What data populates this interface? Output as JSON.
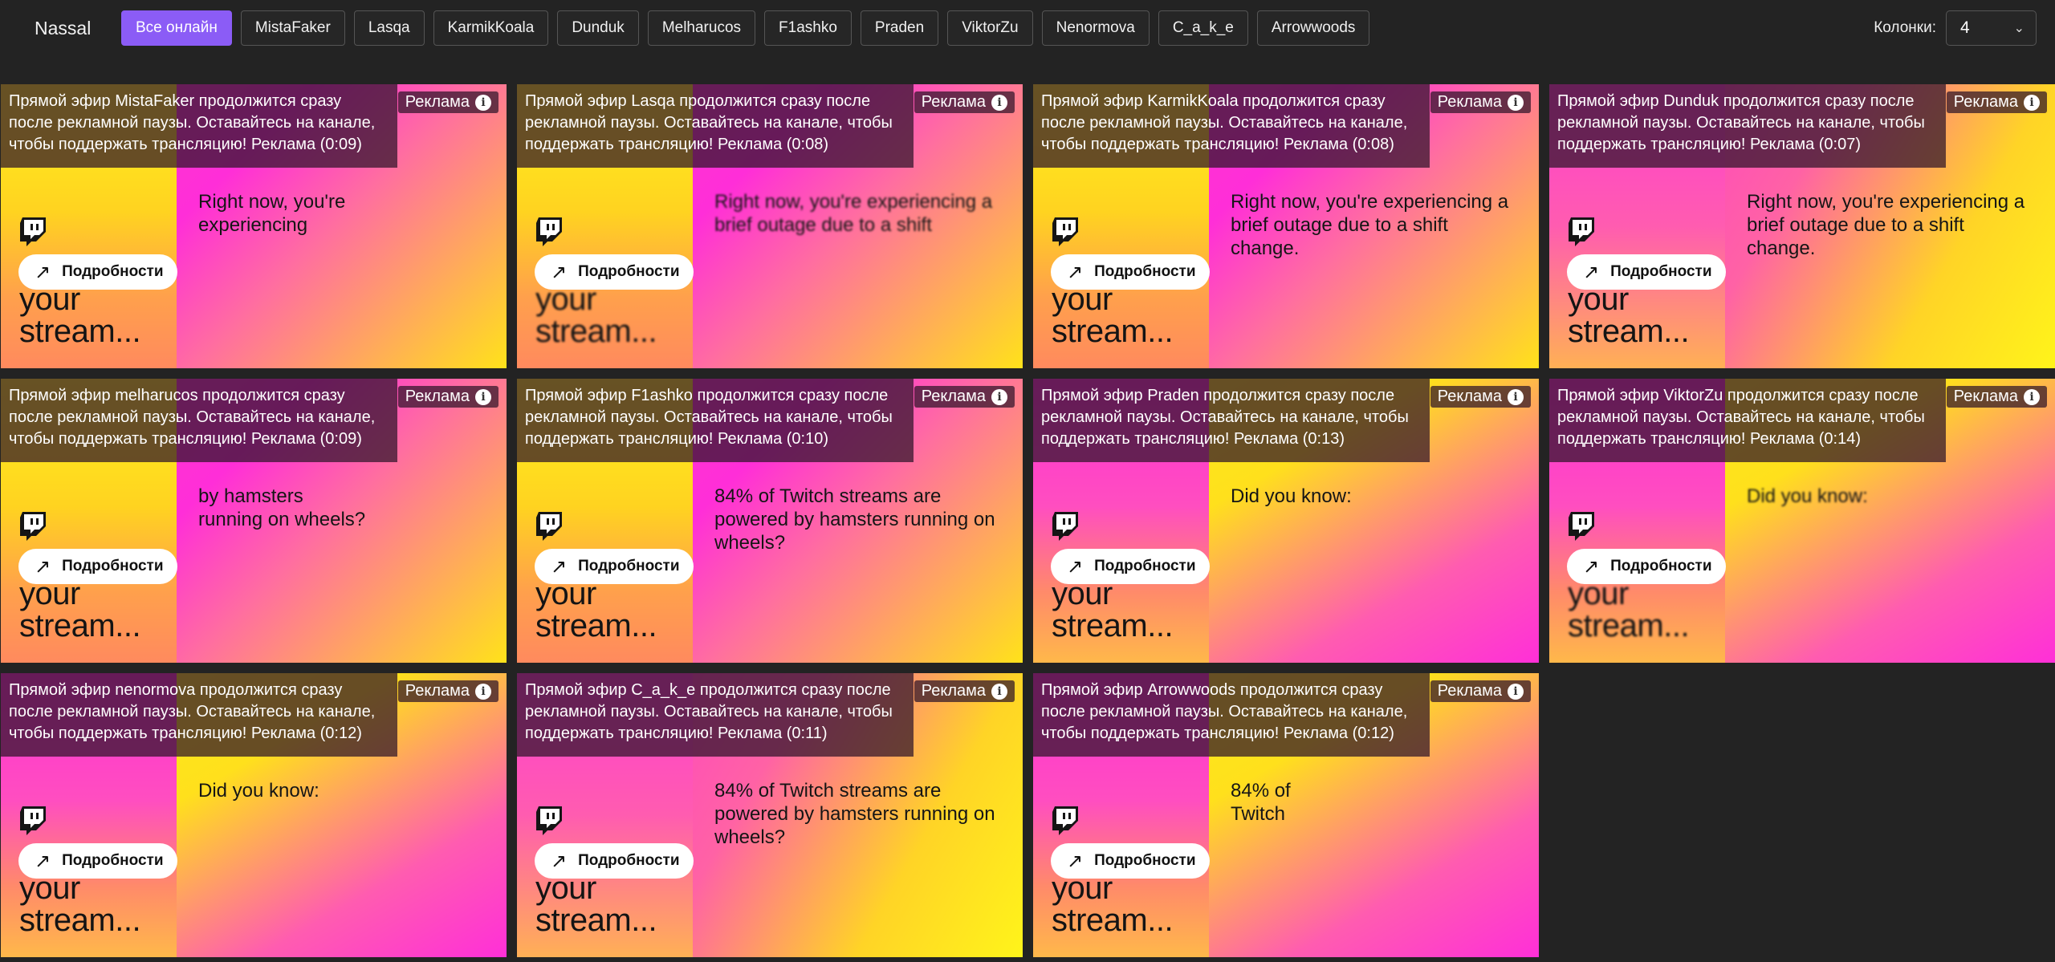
{
  "app": {
    "brand": "Nassal"
  },
  "tabs": [
    {
      "label": "Все онлайн",
      "active": true
    },
    {
      "label": "MistaFaker"
    },
    {
      "label": "Lasqa"
    },
    {
      "label": "KarmikKoala"
    },
    {
      "label": "Dunduk"
    },
    {
      "label": "Melharucos"
    },
    {
      "label": "F1ashko"
    },
    {
      "label": "Praden"
    },
    {
      "label": "ViktorZu"
    },
    {
      "label": "Nenormova"
    },
    {
      "label": "C_a_k_e"
    },
    {
      "label": "Arrowwoods"
    }
  ],
  "columns": {
    "label": "Колонки:",
    "value": "4"
  },
  "common": {
    "ad_badge": "Реклама",
    "details": "Подробности",
    "stream_line1": "your",
    "stream_line2": "stream..."
  },
  "tiles": [
    {
      "message": "Прямой эфир MistaFaker продолжится сразу после рекламной паузы. Оставайтесь на канале, чтобы поддержать трансляцию! Реклама (0:09)",
      "promo": "Right now, you're\nexperiencing",
      "variant": "v1"
    },
    {
      "message": "Прямой эфир Lasqa продолжится сразу после рекламной паузы. Оставайтесь на канале, чтобы поддержать трансляцию! Реклама (0:08)",
      "promo": "Right now, you're experiencing a brief outage due to a shift",
      "variant": "v1"
    },
    {
      "message": "Прямой эфир KarmikKoala продолжится сразу после рекламной паузы. Оставайтесь на канале, чтобы поддержать трансляцию! Реклама (0:08)",
      "promo": "Right now, you're experiencing a brief outage due to a shift change.",
      "variant": "v1"
    },
    {
      "message": "Прямой эфир Dunduk продолжится сразу после рекламной паузы. Оставайтесь на канале, чтобы поддержать трансляцию! Реклама (0:07)",
      "promo": "Right now, you're experiencing a brief outage due to a shift change.",
      "variant": "v2"
    },
    {
      "message": "Прямой эфир melharucos продолжится сразу после рекламной паузы. Оставайтесь на канале, чтобы поддержать трансляцию! Реклама (0:09)",
      "promo": "by hamsters\nrunning on wheels?",
      "variant": "v1"
    },
    {
      "message": "Прямой эфир F1ashko продолжится сразу после рекламной паузы. Оставайтесь на канале, чтобы поддержать трансляцию! Реклама (0:10)",
      "promo": "84% of Twitch streams are powered by hamsters running on wheels?",
      "variant": "v1"
    },
    {
      "message": "Прямой эфир Praden продолжится сразу после рекламной паузы. Оставайтесь на канале, чтобы поддержать трансляцию! Реклама (0:13)",
      "promo": "Did you know:",
      "variant": "v3"
    },
    {
      "message": "Прямой эфир ViktorZu продолжится сразу после рекламной паузы. Оставайтесь на канале, чтобы поддержать трансляцию! Реклама (0:14)",
      "promo": "Did you know:",
      "variant": "v3"
    },
    {
      "message": "Прямой эфир nenormova продолжится сразу после рекламной паузы. Оставайтесь на канале, чтобы поддержать трансляцию! Реклама (0:12)",
      "promo": "Did you know:",
      "variant": "v3"
    },
    {
      "message": "Прямой эфир C_a_k_e продолжится сразу после рекламной паузы. Оставайтесь на канале, чтобы поддержать трансляцию! Реклама (0:11)",
      "promo": "84% of Twitch streams are powered by hamsters running on wheels?",
      "variant": "v2"
    },
    {
      "message": "Прямой эфир Arrowwoods продолжится сразу после рекламной паузы. Оставайтесь на канале, чтобы поддержать трансляцию! Реклама (0:12)",
      "promo": "84% of\nTwitch",
      "variant": "v3"
    }
  ]
}
